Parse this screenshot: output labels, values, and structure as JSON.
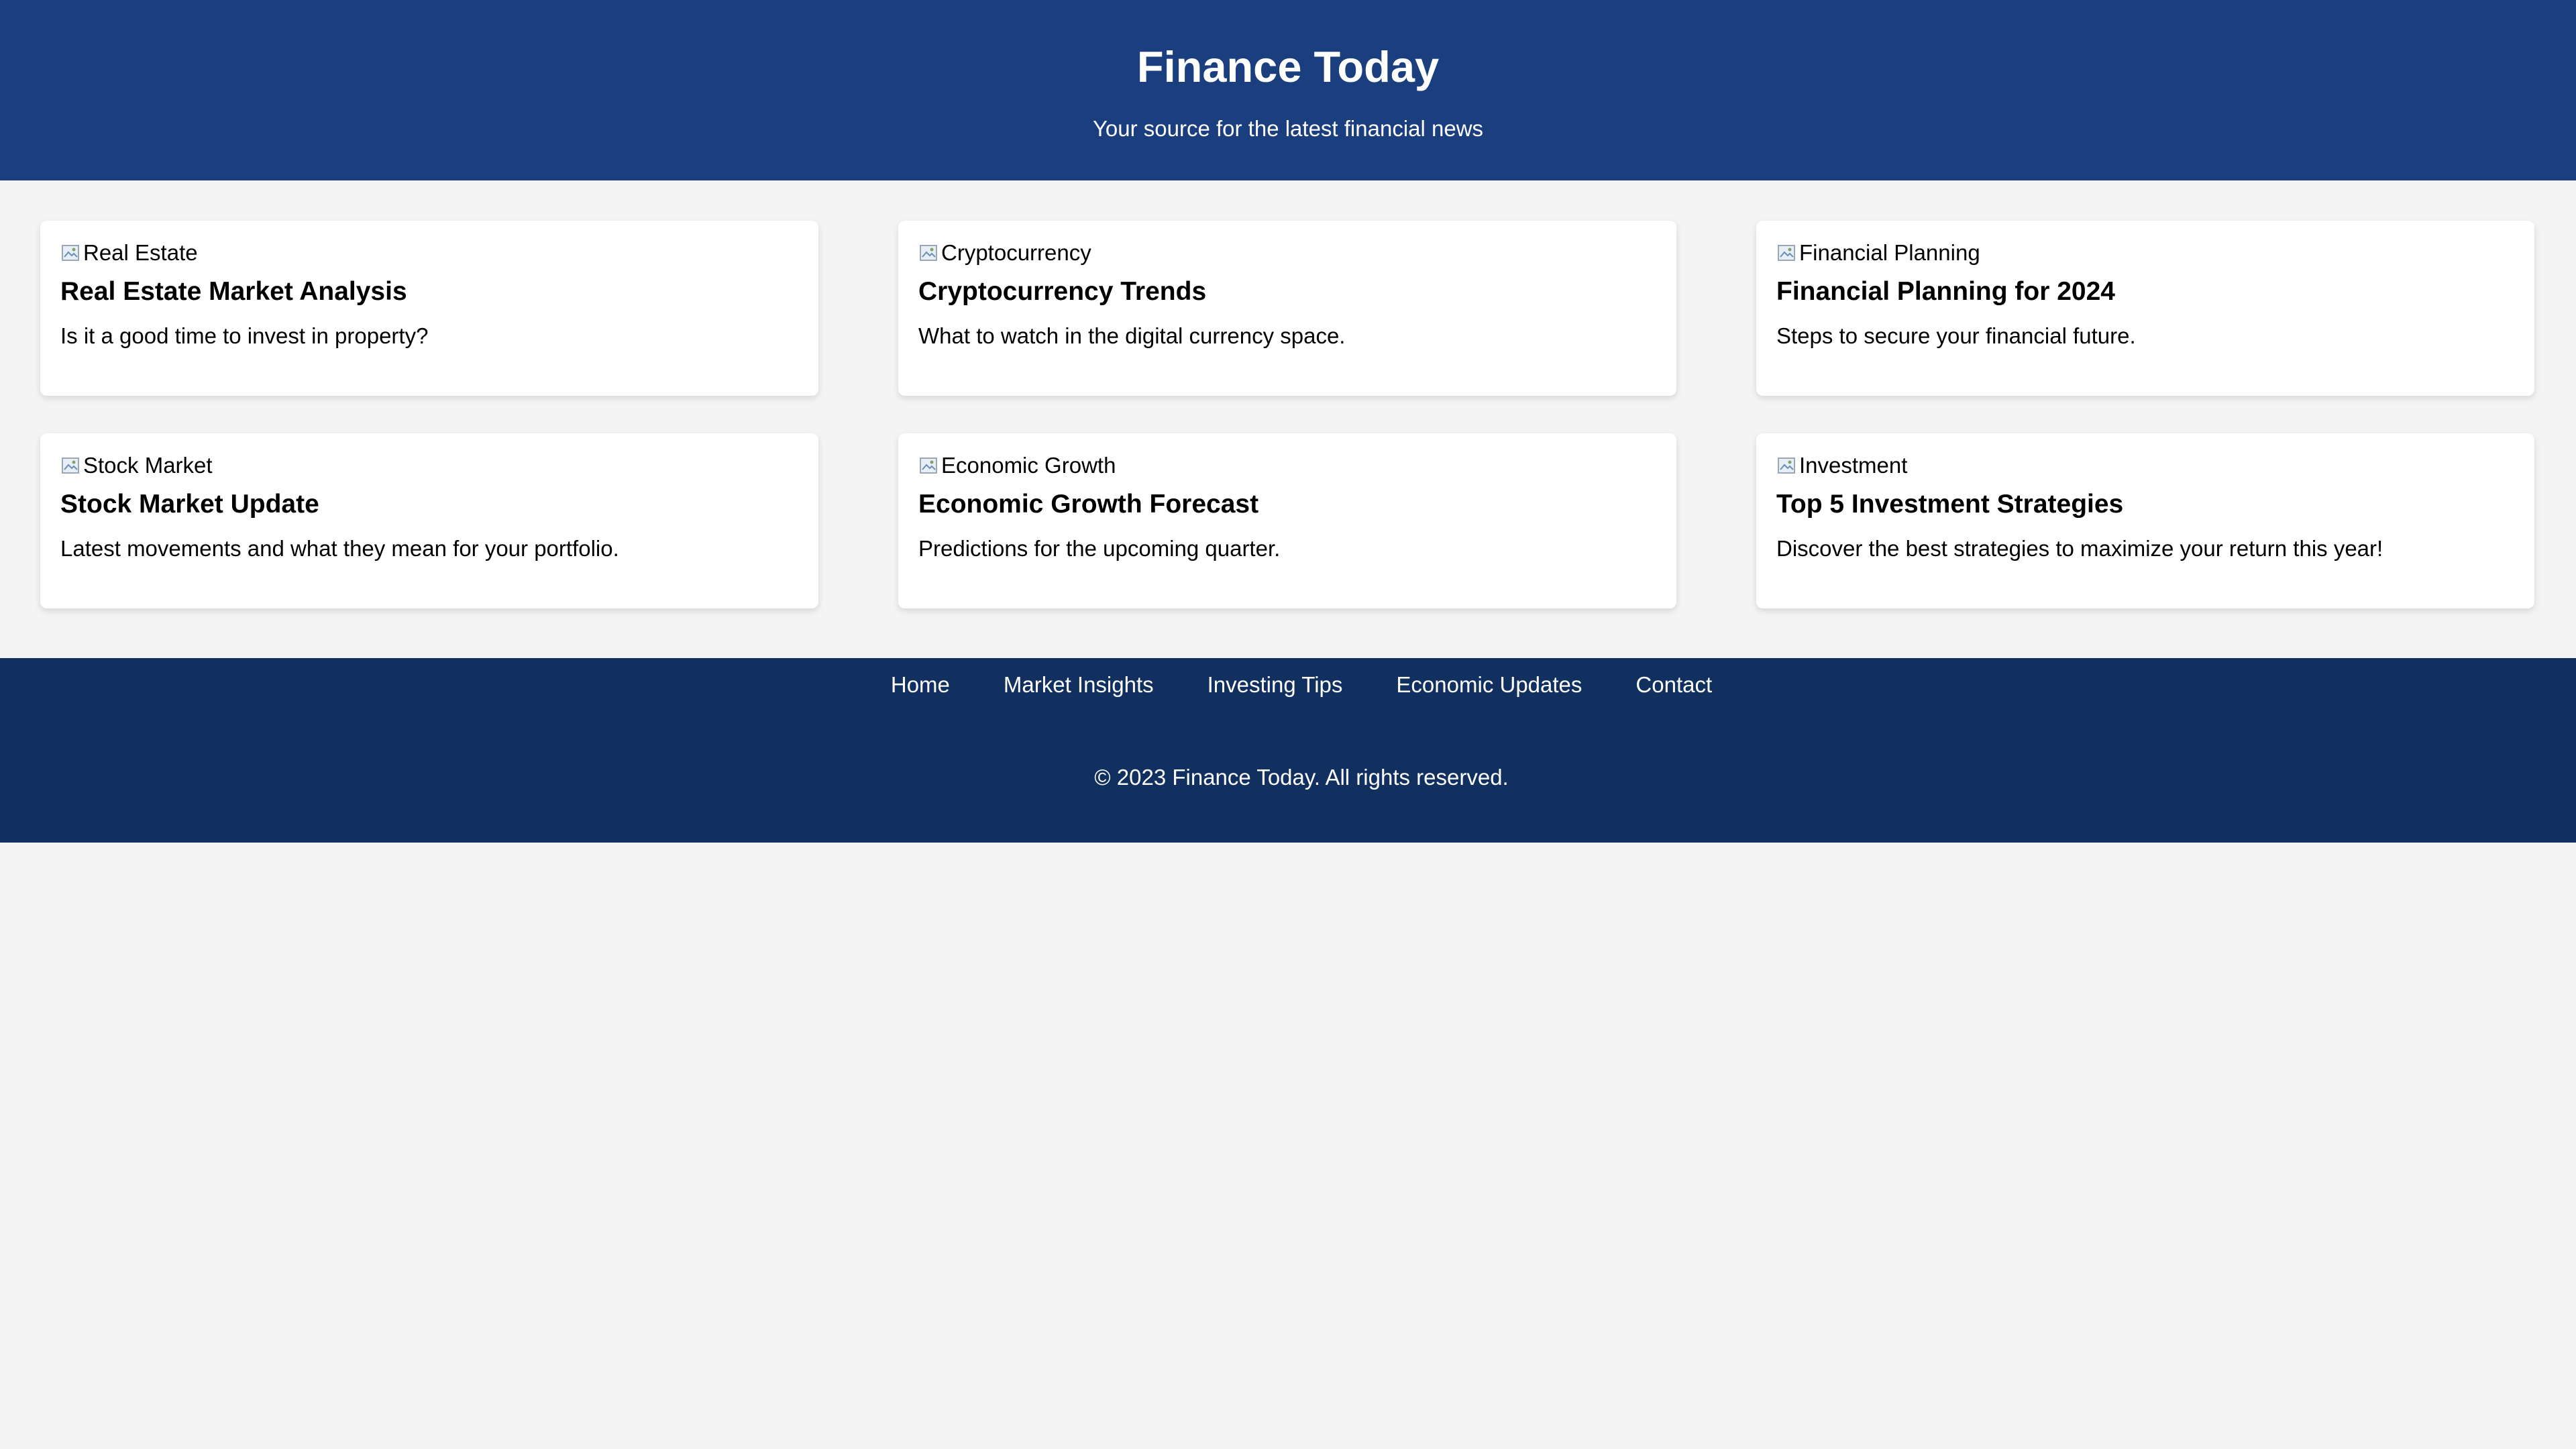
{
  "header": {
    "title": "Finance Today",
    "subtitle": "Your source for the latest financial news"
  },
  "articles": [
    {
      "image_alt": "Real Estate",
      "title": "Real Estate Market Analysis",
      "summary": "Is it a good time to invest in property?"
    },
    {
      "image_alt": "Cryptocurrency",
      "title": "Cryptocurrency Trends",
      "summary": "What to watch in the digital currency space."
    },
    {
      "image_alt": "Financial Planning",
      "title": "Financial Planning for 2024",
      "summary": "Steps to secure your financial future."
    },
    {
      "image_alt": "Stock Market",
      "title": "Stock Market Update",
      "summary": "Latest movements and what they mean for your portfolio."
    },
    {
      "image_alt": "Economic Growth",
      "title": "Economic Growth Forecast",
      "summary": "Predictions for the upcoming quarter."
    },
    {
      "image_alt": "Investment",
      "title": "Top 5 Investment Strategies",
      "summary": "Discover the best strategies to maximize your return this year!"
    }
  ],
  "footer": {
    "nav": [
      "Home",
      "Market Insights",
      "Investing Tips",
      "Economic Updates",
      "Contact"
    ],
    "copyright": "© 2023 Finance Today. All rights reserved."
  },
  "colors": {
    "header_bg": "#1a3e7e",
    "footer_bg": "#11305f",
    "page_bg": "#f4f4f4",
    "card_bg": "#ffffff"
  },
  "icons": {
    "article_image": "broken-image-icon"
  }
}
